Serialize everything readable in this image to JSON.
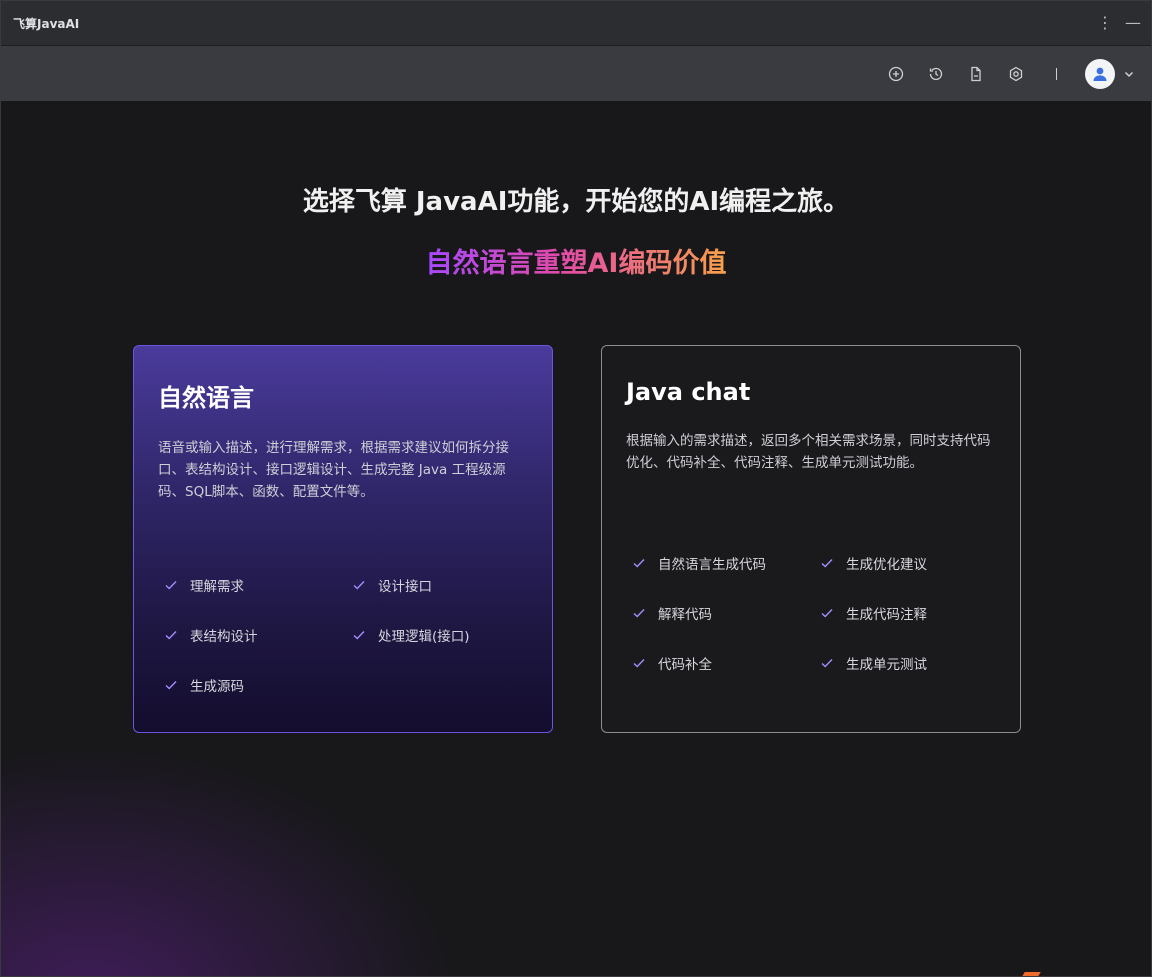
{
  "window": {
    "title": "飞算JavaAI"
  },
  "toolbar": {
    "icons": [
      "add-circle-icon",
      "history-icon",
      "document-icon",
      "settings-icon"
    ],
    "separator": "|"
  },
  "main": {
    "headline": "选择飞算 JavaAI功能，开始您的AI编程之旅。",
    "slogan": "自然语言重塑AI编码价值",
    "cards": [
      {
        "title": "自然语言",
        "description": "语音或输入描述，进行理解需求，根据需求建议如何拆分接口、表结构设计、接口逻辑设计、生成完整 Java 工程级源码、SQL脚本、函数、配置文件等。",
        "features": [
          "理解需求",
          "设计接口",
          "表结构设计",
          "处理逻辑(接口)",
          "生成源码"
        ]
      },
      {
        "title": "Java chat",
        "description": "根据输入的需求描述，返回多个相关需求场景，同时支持代码优化、代码补全、代码注释、生成单元测试功能。",
        "features": [
          "自然语言生成代码",
          "生成优化建议",
          "解释代码",
          "生成代码注释",
          "代码补全",
          "生成单元测试"
        ]
      }
    ]
  },
  "colors": {
    "accent": "#6b55e0",
    "check": "#a58cff",
    "slogan_start": "#a848ff",
    "slogan_end": "#f9a04a"
  }
}
